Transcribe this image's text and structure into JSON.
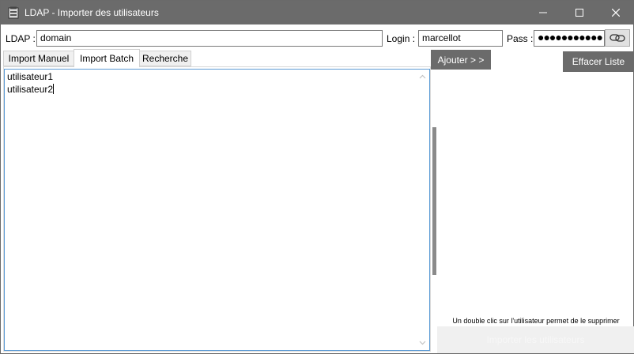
{
  "window": {
    "title": "LDAP - Importer des utilisateurs",
    "controls": {
      "minimize_icon": "minimize-icon",
      "maximize_icon": "maximize-icon",
      "close_icon": "close-icon"
    }
  },
  "connection": {
    "ldap_label": "LDAP :",
    "ldap_value": "domain",
    "login_label": "Login :",
    "login_value": "marcellot",
    "pass_label": "Pass :",
    "pass_value": "●●●●●●●●●●●",
    "connect_icon": "link-icon"
  },
  "tabs": [
    {
      "label": "Import Manuel",
      "active": false
    },
    {
      "label": "Import Batch",
      "active": true
    },
    {
      "label": "Recherche",
      "active": false
    }
  ],
  "batch": {
    "lines": [
      "utilisateur1",
      "utilisateur2"
    ]
  },
  "actions": {
    "add_label": "Ajouter > >",
    "clear_label": "Effacer Liste",
    "hint": "Un double clic sur l'utilisateur permet de le supprimer",
    "import_label": "Importer les utilisateurs"
  },
  "colors": {
    "titlebar": "#6b6b6b",
    "accent_border": "#5b9bd5",
    "button_dark": "#6b6b6b"
  }
}
